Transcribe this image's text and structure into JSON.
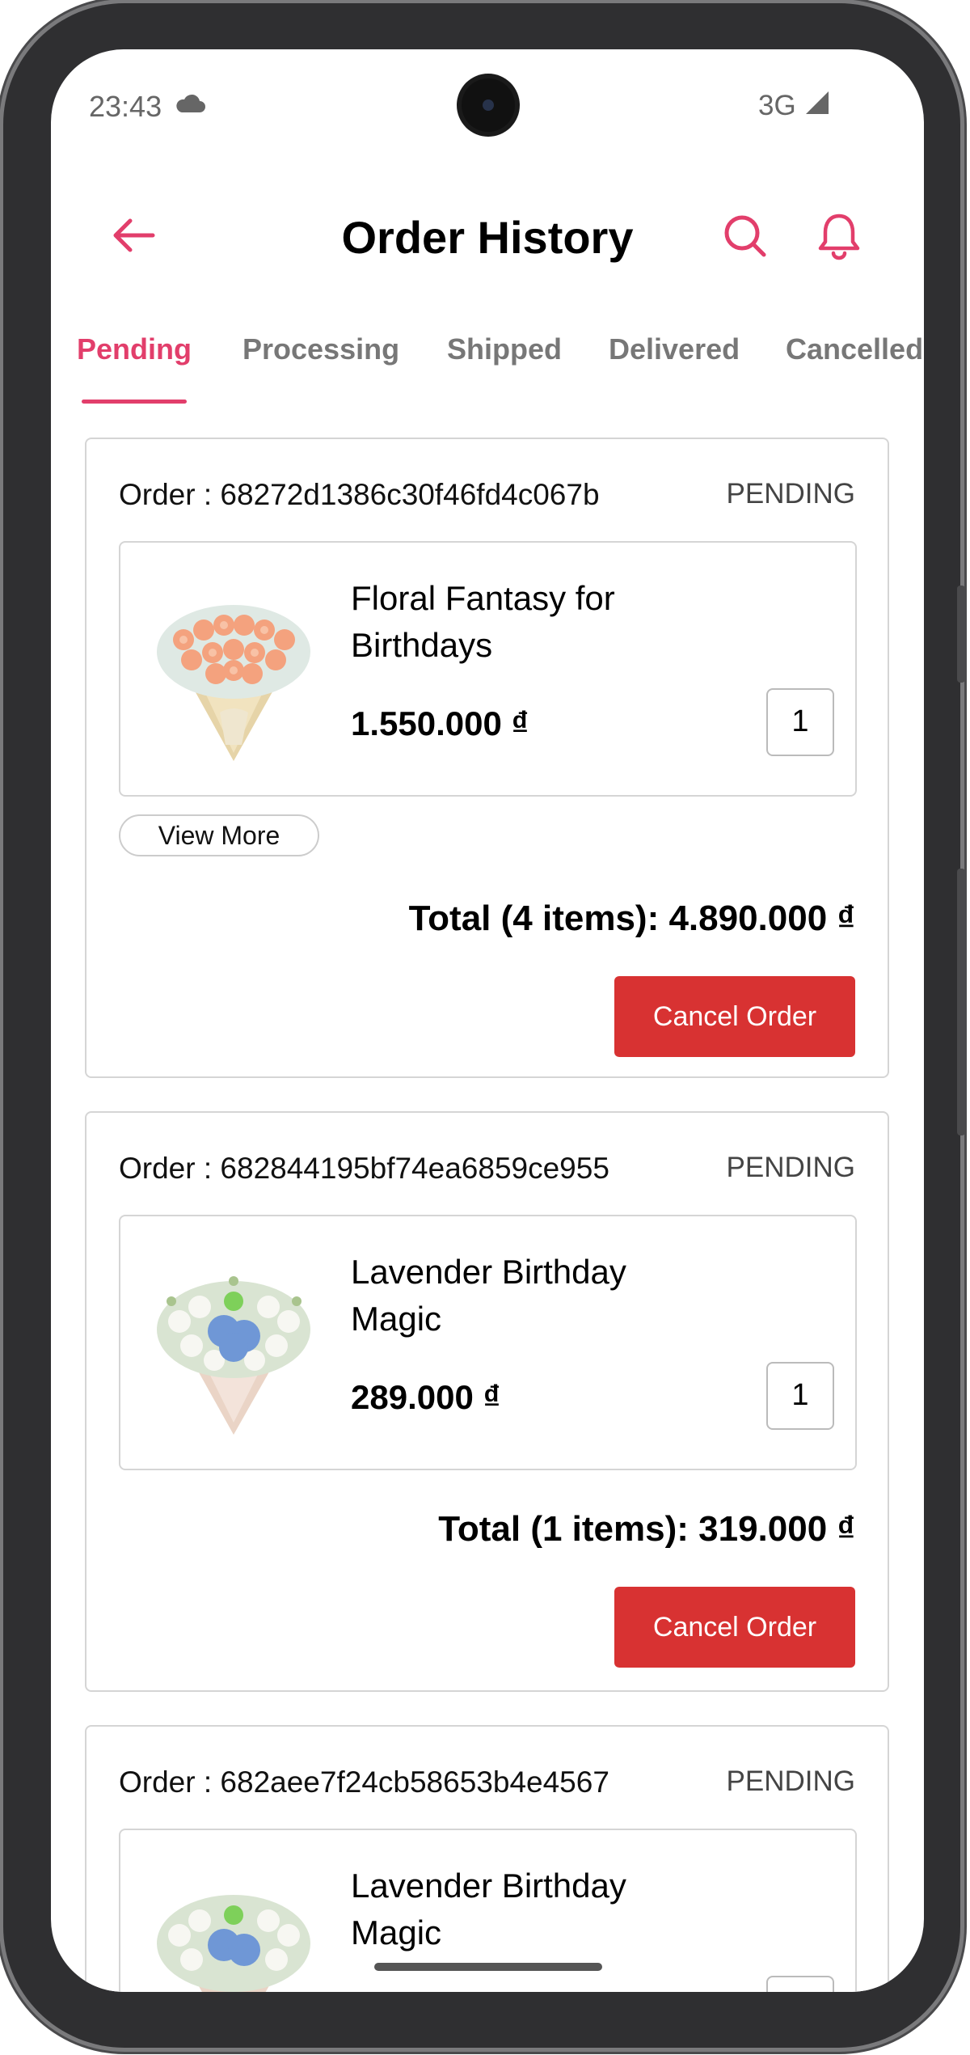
{
  "status_bar": {
    "time": "23:43",
    "network": "3G",
    "icons": [
      "cloud-icon",
      "signal-icon"
    ]
  },
  "header": {
    "title": "Order History",
    "icons": [
      "back-arrow-icon",
      "search-icon",
      "bell-icon"
    ],
    "accent_color": "#e23e6b"
  },
  "tabs": [
    {
      "label": "Pending",
      "active": true
    },
    {
      "label": "Processing",
      "active": false
    },
    {
      "label": "Shipped",
      "active": false
    },
    {
      "label": "Delivered",
      "active": false
    },
    {
      "label": "Cancelled",
      "active": false
    }
  ],
  "orders": [
    {
      "order_label": "Order : 68272d1386c30f46fd4c067b",
      "status": "PENDING",
      "item": {
        "name": "Floral Fantasy for Birthdays",
        "price": "1.550.000 ₫",
        "quantity": "1",
        "image": "peach-rose-bouquet"
      },
      "view_more_label": "View More",
      "total": "Total (4 items): 4.890.000 ₫",
      "cancel_label": "Cancel Order"
    },
    {
      "order_label": "Order : 682844195bf74ea6859ce955",
      "status": "PENDING",
      "item": {
        "name": "Lavender Birthday Magic",
        "price": "289.000 ₫",
        "quantity": "1",
        "image": "blue-white-bouquet"
      },
      "total": "Total (1 items): 319.000 ₫",
      "cancel_label": "Cancel Order"
    },
    {
      "order_label": "Order : 682aee7f24cb58653b4e4567",
      "status": "PENDING",
      "item": {
        "name": "Lavender Birthday Magic",
        "price": "",
        "quantity": "",
        "image": "blue-white-bouquet"
      }
    }
  ],
  "colors": {
    "accent": "#e23e6b",
    "danger": "#d83232",
    "border": "#d5d5d5"
  }
}
